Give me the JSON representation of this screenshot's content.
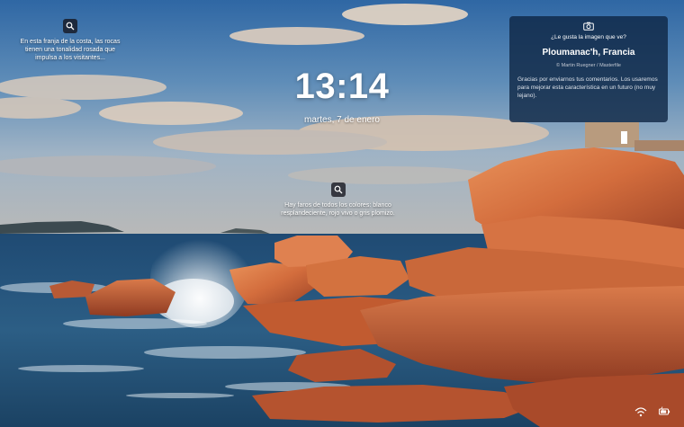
{
  "hotspot_1": {
    "text": "En esta franja de la costa, las rocas tienen una tonalidad rosada que impulsa a los visitantes..."
  },
  "hotspot_2": {
    "text": "Hay faros de todos los colores: blanco resplandeciente, rojo vivo o gris plomizo."
  },
  "clock": {
    "time": "13:14",
    "date": "martes, 7 de enero"
  },
  "info_card": {
    "question": "¿Le gusta la imagen que ve?",
    "location": "Ploumanac'h, Francia",
    "credit": "© Martin Ruegner / Masterfile",
    "thanks": "Gracias por enviarnos tus comentarios. Los usaremos para mejorar esta característica en un futuro (no muy lejano)."
  },
  "tray": {
    "icons": [
      "network-icon",
      "battery-icon"
    ]
  }
}
